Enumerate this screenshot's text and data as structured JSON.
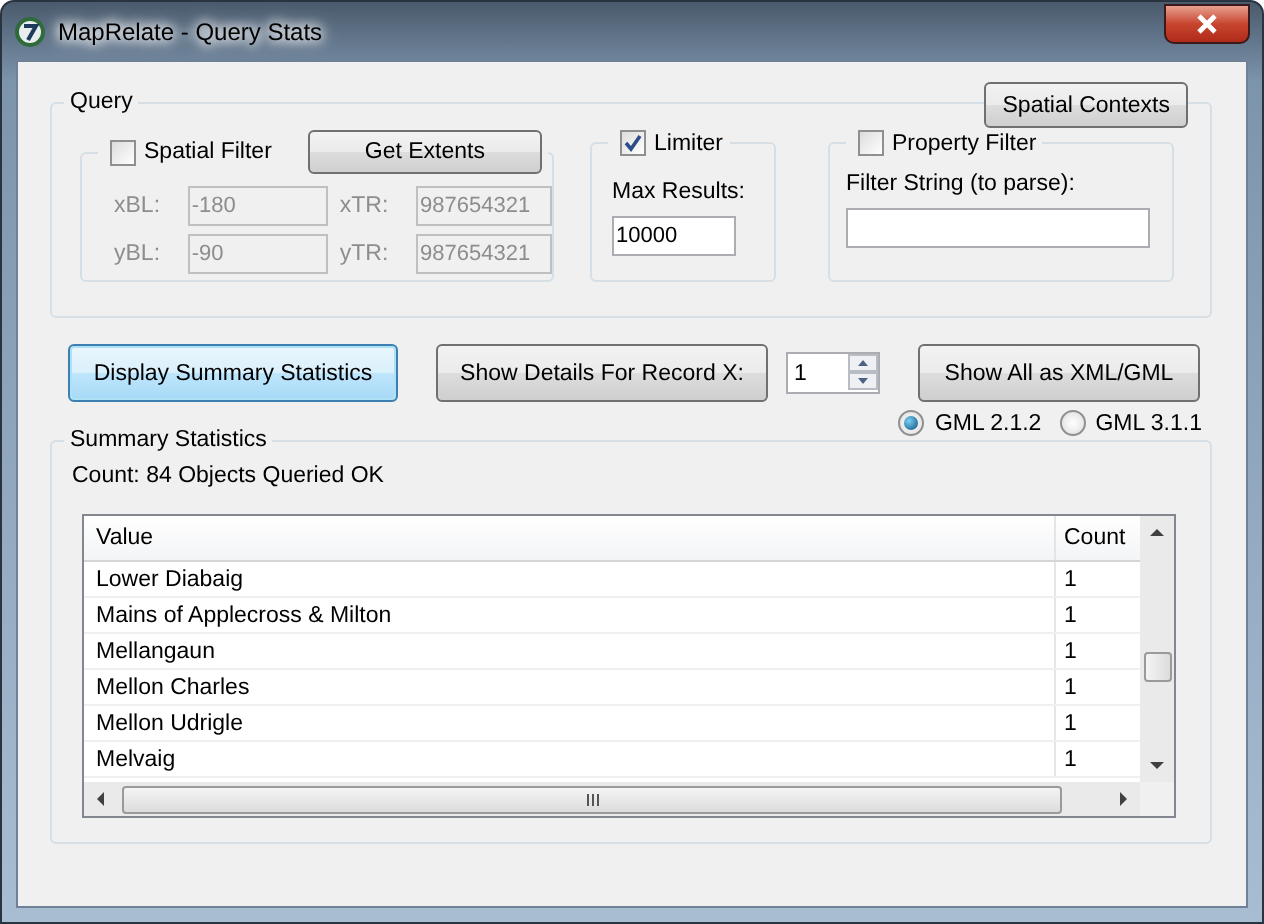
{
  "window": {
    "title": "MapRelate - Query Stats"
  },
  "query": {
    "legend": "Query",
    "spatial_contexts_button": "Spatial Contexts",
    "spatial_filter": {
      "label": "Spatial Filter",
      "checked": false,
      "get_extents_button": "Get Extents",
      "disabled": true,
      "fields": [
        {
          "label": "xBL:",
          "value": "-180"
        },
        {
          "label": "xTR:",
          "value": "987654321"
        },
        {
          "label": "yBL:",
          "value": "-90"
        },
        {
          "label": "yTR:",
          "value": "987654321"
        }
      ]
    },
    "limiter": {
      "label": "Limiter",
      "checked": true,
      "max_results_label": "Max Results:",
      "max_results": "10000"
    },
    "property_filter": {
      "label": "Property Filter",
      "checked": false,
      "filter_label": "Filter String (to parse):"
    }
  },
  "actions": {
    "display_summary": {
      "label": "Display Summary Statistics",
      "focused": true
    },
    "show_details": "Show Details For Record X:",
    "record": "1",
    "show_all": "Show All as XML/GML"
  },
  "formats": [
    {
      "label": "GML 2.1.2",
      "selected": true
    },
    {
      "label": "GML 3.1.1",
      "selected": false
    }
  ],
  "summary": {
    "legend": "Summary Statistics",
    "count_text": "Count: 84 Objects Queried OK",
    "columns": [
      "Value",
      "Count"
    ],
    "rows": [
      {
        "value": "Lower Diabaig",
        "count": "1"
      },
      {
        "value": "Mains of Applecross & Milton",
        "count": "1"
      },
      {
        "value": "Mellangaun",
        "count": "1"
      },
      {
        "value": "Mellon Charles",
        "count": "1"
      },
      {
        "value": "Mellon Udrigle",
        "count": "1"
      },
      {
        "value": "Melvaig",
        "count": "1"
      }
    ]
  }
}
